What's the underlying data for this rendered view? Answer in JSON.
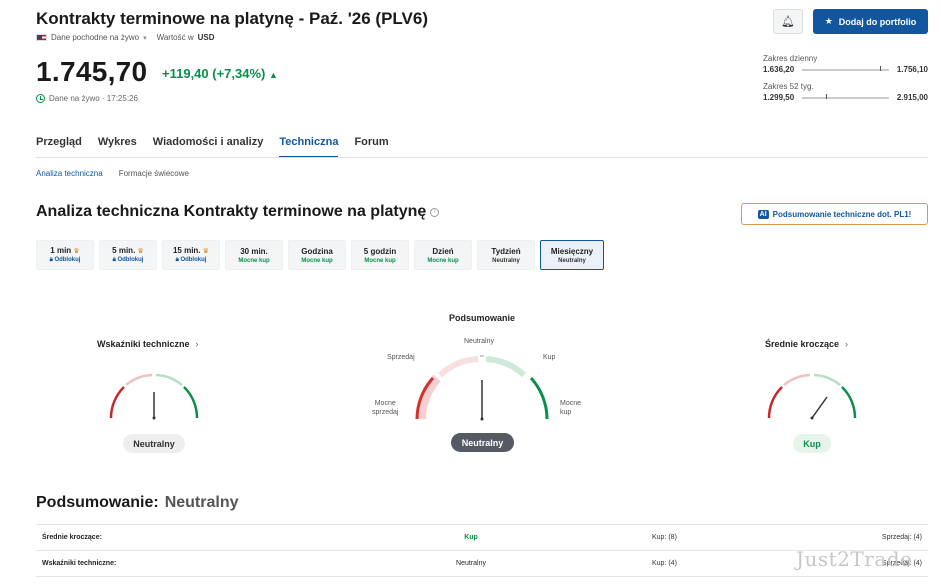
{
  "header": {
    "title": "Kontrakty terminowe na platynę - Paź. '26 (PLV6)",
    "data_source": "Dane pochodne na żywo",
    "currency_label": "Wartość w",
    "currency": "USD",
    "price": "1.745,70",
    "change": "+119,40 (+7,34%)",
    "timestamp": "Dane na żywo · 17:25:26",
    "add_portfolio": "Dodaj do portfolio"
  },
  "ranges": {
    "daily": {
      "label": "Zakres dzienny",
      "low": "1.636,20",
      "high": "1.756,10",
      "position": 0.9
    },
    "week52": {
      "label": "Zakres 52 tyg.",
      "low": "1.299,50",
      "high": "2.915,00",
      "position": 0.27
    }
  },
  "tabs": [
    {
      "label": "Przegląd"
    },
    {
      "label": "Wykres"
    },
    {
      "label": "Wiadomości i analizy"
    },
    {
      "label": "Techniczna"
    },
    {
      "label": "Forum"
    }
  ],
  "subtabs": [
    {
      "label": "Analiza techniczna"
    },
    {
      "label": "Formacje świecowe"
    }
  ],
  "analysis": {
    "title": "Analiza techniczna Kontrakty terminowe na platynę",
    "ai_button": "Podsumowanie techniczne dot. PL1!",
    "periods": [
      {
        "name": "1 min",
        "value": "Odblokuj"
      },
      {
        "name": "5 min.",
        "value": "Odblokuj"
      },
      {
        "name": "15 min.",
        "value": "Odblokuj"
      },
      {
        "name": "30 min.",
        "value": "Mocne kup"
      },
      {
        "name": "Godzina",
        "value": "Mocne kup"
      },
      {
        "name": "5 godzin",
        "value": "Mocne kup"
      },
      {
        "name": "Dzień",
        "value": "Mocne kup"
      },
      {
        "name": "Tydzień",
        "value": "Neutralny"
      },
      {
        "name": "Miesięczny",
        "value": "Neutralny"
      }
    ]
  },
  "gauges": {
    "indicators": {
      "title": "Wskaźniki techniczne",
      "result": "Neutralny"
    },
    "summary": {
      "title": "Podsumowanie",
      "result": "Neutralny",
      "labels": {
        "strong_sell": "Mocne\nsprzedaj",
        "sell": "Sprzedaj",
        "neutral": "Neutralny",
        "buy": "Kup",
        "strong_buy": "Mocne\nkup"
      }
    },
    "moving_averages": {
      "title": "Średnie kroczące",
      "result": "Kup"
    }
  },
  "summary": {
    "title": "Podsumowanie:",
    "result": "Neutralny",
    "rows": [
      {
        "name": "Średnie kroczące:",
        "value": "Kup",
        "buy": "Kup: (8)",
        "sell": "Sprzedaj: (4)"
      },
      {
        "name": "Wskaźniki techniczne:",
        "value": "Neutralny",
        "buy": "Kup: (4)",
        "sell": "Sprzedaj: (4)"
      }
    ]
  },
  "watermark": "Just2Trade",
  "colors": {
    "accent": "#1256a0",
    "buy": "#0a8f4b",
    "sell": "#c62828"
  }
}
